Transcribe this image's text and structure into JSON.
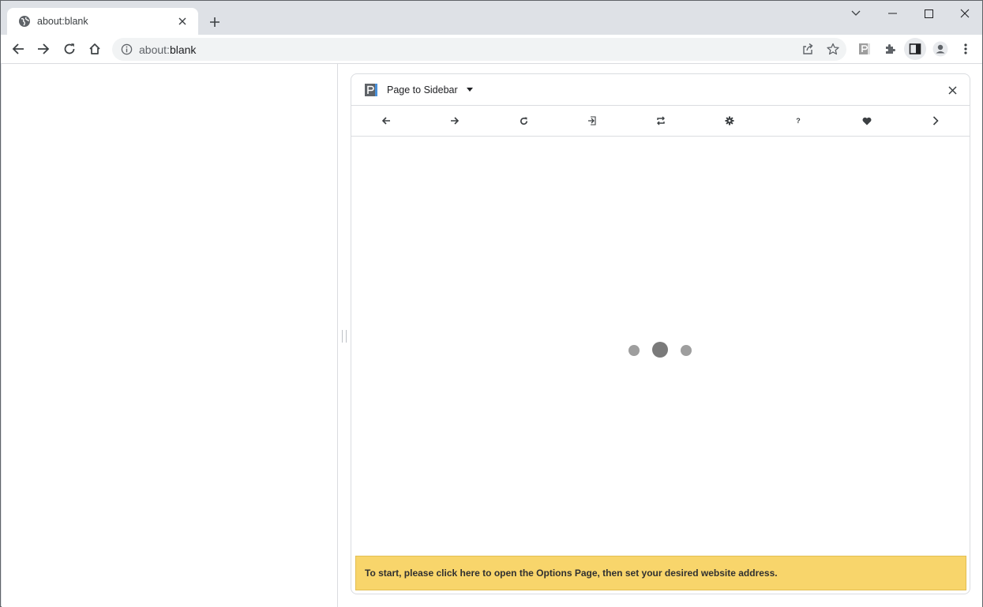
{
  "tab": {
    "title": "about:blank"
  },
  "omnibox": {
    "url_scheme": "about:",
    "url_rest": "blank"
  },
  "side_panel": {
    "title": "Page to Sidebar",
    "toolbar_help_label": "?",
    "banner_text": "To start, please click here to open the Options Page, then set your desired website address."
  },
  "colors": {
    "banner_bg": "#f8d56b",
    "chrome_frame": "#dee1e6",
    "toolbar_bg": "#ffffff",
    "logo_accent": "#4a90d9"
  }
}
